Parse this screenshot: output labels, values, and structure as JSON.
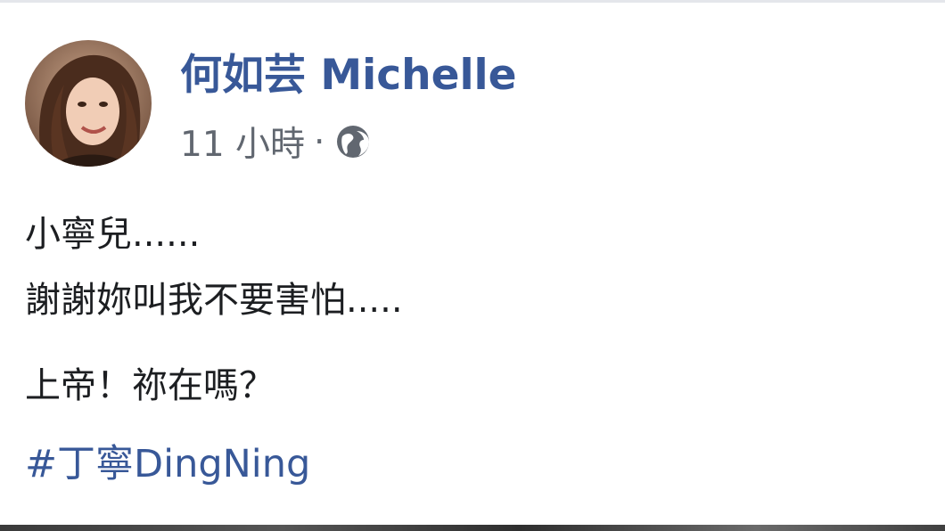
{
  "post": {
    "author_name": "何如芸 Michelle",
    "timestamp": "11 小時",
    "separator": "·",
    "audience_icon": "globe-icon",
    "text_lines": [
      "小寧兒......",
      "謝謝妳叫我不要害怕.....",
      "上帝！祢在嗎？"
    ],
    "hashtag": "#丁寧DingNing"
  },
  "colors": {
    "author_link": "#385898",
    "meta_text": "#616770",
    "body_text": "#1c1e21",
    "background": "#ffffff"
  }
}
